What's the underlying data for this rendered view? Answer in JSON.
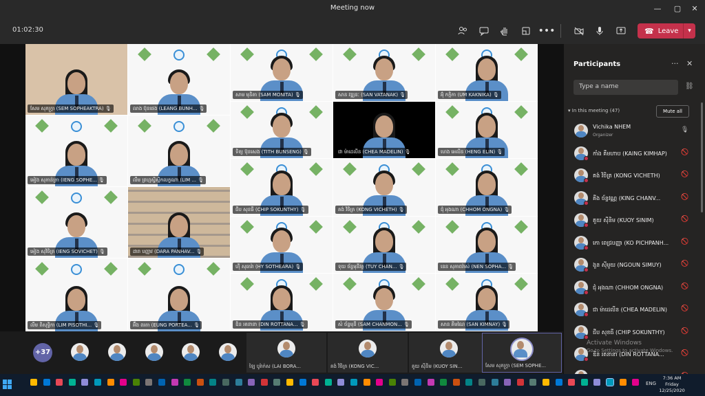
{
  "window": {
    "title": "Meeting now",
    "controls": [
      "—",
      "▢",
      "✕"
    ]
  },
  "toolbar": {
    "timer": "01:02:30",
    "leave_label": "Leave",
    "icons": [
      "participants-icon",
      "chat-icon",
      "raise-hand-icon",
      "breakout-icon",
      "more-icon",
      "camera-icon",
      "microphone-icon",
      "share-icon"
    ]
  },
  "tiles": [
    {
      "name": "សែម សុភក្រ្តា (SEM SOPHEAKTRA)"
    },
    {
      "name": "លាង ប៊ុនផេង (LEANG BUNH..."
    },
    {
      "name": "សាម មុនិតា (SAM MONITA)"
    },
    {
      "name": "សាន វឌ្ឍនៈ (SAN VATANAK)"
    },
    {
      "name": "អ៊ុំ កក្កិកា (UM KAKNIKA)"
    },
    {
      "name": "អៀង សុភាន់ក្រា (IENG SOPHE..."
    },
    {
      "name": "លឹម ព្រហ្មស្វិស្តិកលក្ខណា (LIM ..."
    },
    {
      "name": "ទិត្យ ប៊ុនសេង (TITH BUNSENG)"
    },
    {
      "name": "ជា ម៉ាដេលីន (CHEA MADELIN)"
    },
    {
      "name": "ហេង អេលីន (HENG ELIN)"
    },
    {
      "name": "ជីប សុខធី (CHIP SOKUNTHY)"
    },
    {
      "name": "គង់ វិចិត្រ (KONG VICHETH)"
    },
    {
      "name": "ជុំ អុងណា (CHHOM ONGNA)"
    },
    {
      "name": "អៀង សុវិចិត្រ (IENG SOVICHET)"
    },
    {
      "name": "ដារា បញ្ញាវ (DARA PANHAV..."
    },
    {
      "name": "ហ៊ី សុធារ៉ា (HY SOTHEARA)"
    },
    {
      "name": "ទុយ ច័ន្ទមុនីវត្ថ (TUY CHAN..."
    },
    {
      "name": "នេន សុភាពរ៉ាស់ (NEN SOPHA..."
    },
    {
      "name": "លឹម ពិសុទ្ធិកា (LIM PISOTHI..."
    },
    {
      "name": "អ៊ឹង ពរតា (EUNG PORTEA..."
    },
    {
      "name": "ឌិន រតនានា (DIN ROTTANA..."
    },
    {
      "name": "សំ ច័ន្ទមុនី (SAM CHANMON..."
    },
    {
      "name": "សាន គីមណៃ (SAN KIMNAY)"
    }
  ],
  "strip": {
    "more_count": "+37",
    "tiles": [
      {
        "name": "ឡៃ បូរ៉ាក់ស (LAI BORA..."
      },
      {
        "name": "គង់ វិចិត្រ (KONG VIC..."
      },
      {
        "name": "គួយ ស៊ីនិម (KUOY SIN..."
      },
      {
        "name": "សែម សុភក្រ្តា (SEM SOPHE..."
      }
    ]
  },
  "panel": {
    "title": "Participants",
    "search_placeholder": "Type a name",
    "section_label": "In this meeting (47)",
    "mute_all_label": "Mute all",
    "participants": [
      {
        "name": "Vichika NHEM",
        "role": "Organizer"
      },
      {
        "name": "កាំង គឹមហាប (KAING KIMHAP)",
        "role": ""
      },
      {
        "name": "គង់ វិចិត្រ (KONG VICHETH)",
        "role": ""
      },
      {
        "name": "គីង ច័ន្ទវណ្ណ (KING CHANV...",
        "role": ""
      },
      {
        "name": "គួយ ស៊ីនិម (KUOY SINIM)",
        "role": ""
      },
      {
        "name": "កោ ពេជ្របញ្ញា (KO PICHPANH...",
        "role": ""
      },
      {
        "name": "ងួន ស៊ីមួយ (NGOUN SIMUY)",
        "role": ""
      },
      {
        "name": "ជុំ អុងណា (CHHOM ONGNA)",
        "role": ""
      },
      {
        "name": "ជា ម៉ាដេលីន (CHEA MADELIN)",
        "role": ""
      },
      {
        "name": "ជីប សុខធី (CHIP SOKUNTHY)",
        "role": ""
      },
      {
        "name": "ឌិន រតនានា (DIN ROTTANA...",
        "role": ""
      },
      {
        "name": "តន រតនា (TONN ROTANA)",
        "role": ""
      }
    ]
  },
  "watermark": {
    "line1": "Activate Windows",
    "line2": "Go to Settings to activate Windows."
  },
  "taskbar": {
    "time": "7:36 AM",
    "day": "Friday",
    "date": "12/25/2020",
    "lang": "ENG"
  }
}
